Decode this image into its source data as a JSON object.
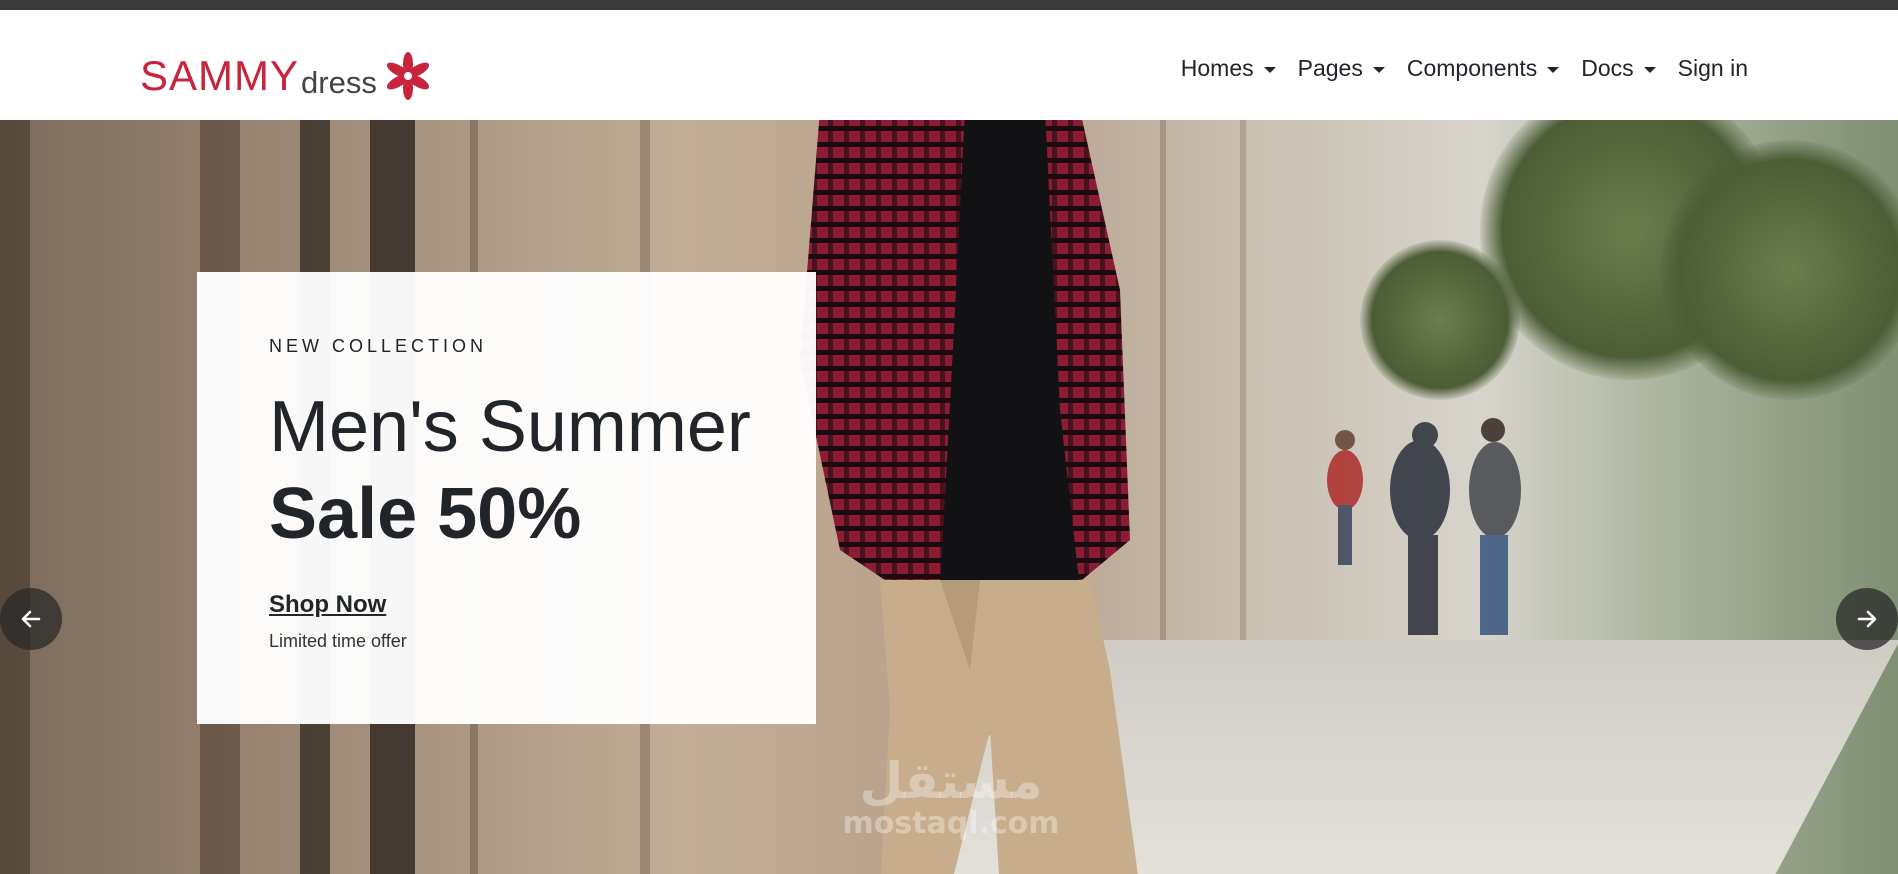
{
  "header": {
    "logo_main": "SAMMY",
    "logo_sub": "dress",
    "nav": [
      {
        "label": "Homes",
        "has_dropdown": true
      },
      {
        "label": "Pages",
        "has_dropdown": true
      },
      {
        "label": "Components",
        "has_dropdown": true
      },
      {
        "label": "Docs",
        "has_dropdown": true
      },
      {
        "label": "Sign in",
        "has_dropdown": false
      }
    ]
  },
  "hero": {
    "eyebrow": "NEW COLLECTION",
    "headline_1": "Men's Summer",
    "headline_2": "Sale 50%",
    "cta": "Shop Now",
    "subtext": "Limited time offer",
    "prev_icon": "arrow-left-icon",
    "next_icon": "arrow-right-icon"
  },
  "watermark": {
    "arabic": "مستقل",
    "latin": "mostaql.com"
  },
  "colors": {
    "brand_red": "#c8243c",
    "text_dark": "#212529",
    "top_strip": "#3a3a3a"
  }
}
